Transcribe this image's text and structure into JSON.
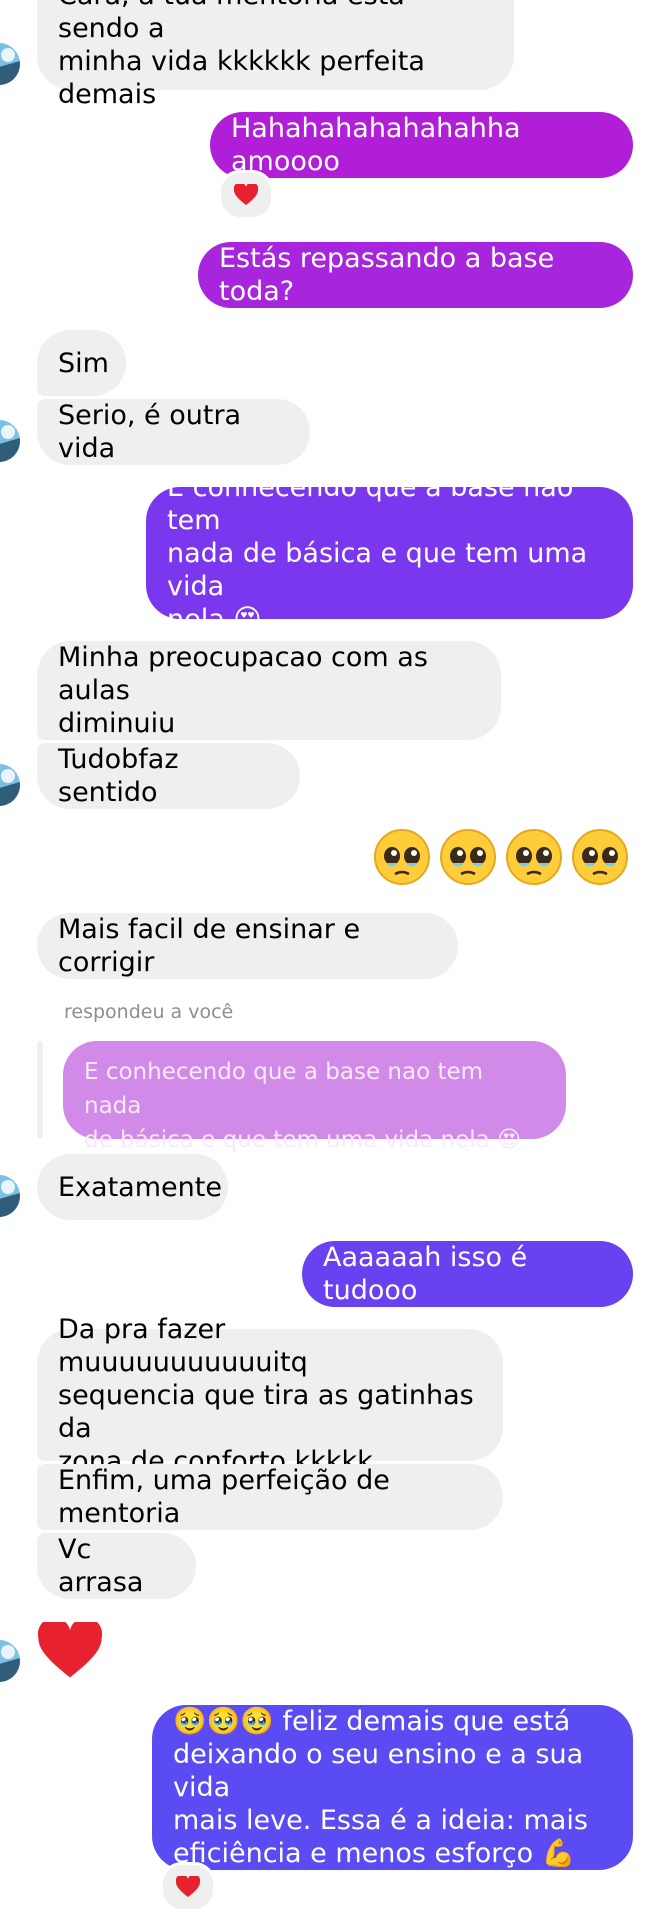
{
  "messages": {
    "m1": "Cara, a tua mentoria esta sendo a\nminha vida kkkkkk perfeita demais",
    "m2": "Hahahahahahahahha amoooo",
    "m3": "Estás repassando a base toda?",
    "m4": "Sim",
    "m5": "Serio, é outra vida",
    "m6": "E conhecendo que a base nao tem\nnada de básica e que tem uma vida\nnela 😍",
    "m7": "Minha preocupacao com as aulas\ndiminuiu",
    "m8": "Tudobfaz sentido",
    "m9": "Mais facil de ensinar e corrigir",
    "m10": "Exatamente",
    "m11": "Aaaaaah isso é tudooo",
    "m12": "Da pra fazer muuuuuuuuuuuitq\nsequencia que tira as gatinhas da\nzona de conforto kkkkk",
    "m13": "Enfim, uma perfeição de mentoria",
    "m14": "Vc arrasa",
    "m15": "🥹🥹🥹 feliz demais que está\ndeixando o seu ensino e a sua vida\nmais leve. Essa é a ideia: mais\neficiência e menos esforço 💪"
  },
  "reply": {
    "label": "respondeu a você",
    "quote": "E conhecendo que a base nao tem nada\nde básica e que tem uma vida nela 😍"
  },
  "colors": {
    "incoming_bg": "#efefef",
    "outgoing_top": "#b01ed8",
    "outgoing_mid": "#7b37ee",
    "outgoing_bottom": "#5a4cf2",
    "heart": "#e8212e"
  },
  "icons": {
    "reaction": "heart-icon",
    "avatar": "profile-avatar",
    "pleading": "pleading-face-emoji"
  }
}
